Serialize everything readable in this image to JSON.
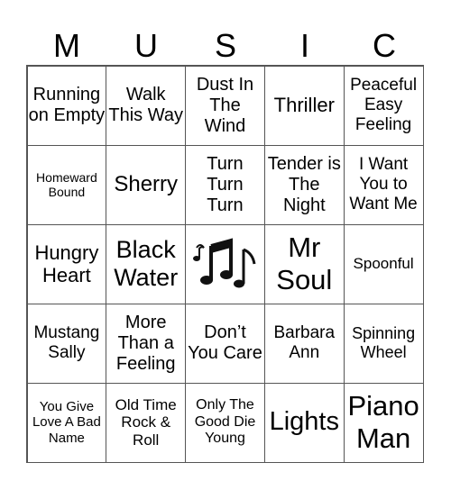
{
  "header": {
    "letters": [
      "M",
      "U",
      "S",
      "I",
      "C"
    ]
  },
  "cells": [
    [
      "Running on Empty",
      "Walk This Way",
      "Dust In The Wind",
      "Thriller",
      "Peaceful Easy Feeling"
    ],
    [
      "Homeward Bound",
      "Sherry",
      "Turn Turn Turn",
      "Tender is The Night",
      "I Want You to Want Me"
    ],
    [
      "Hungry Heart",
      "Black Water",
      "",
      "Mr Soul",
      "Spoonful"
    ],
    [
      "Mustang Sally",
      "More Than a Feeling",
      "Don’t You Care",
      "Barbara Ann",
      "Spinning Wheel"
    ],
    [
      "You Give Love A Bad Name",
      "Old Time Rock & Roll",
      "Only The Good Die Young",
      "Lights",
      "Piano Man"
    ]
  ],
  "free_space": {
    "icon": "music-notes-icon"
  }
}
